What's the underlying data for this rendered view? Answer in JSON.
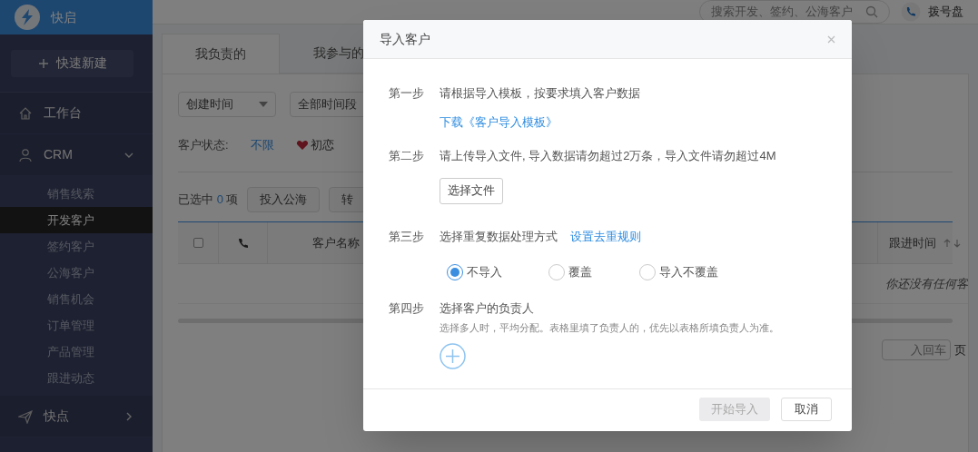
{
  "app": {
    "name": "快启",
    "quick_create": "快速新建"
  },
  "sidebar": {
    "items": [
      {
        "label": "工作台",
        "kind": "home"
      },
      {
        "label": "CRM",
        "kind": "user",
        "expanded": true,
        "children": [
          {
            "label": "销售线索",
            "selected": false
          },
          {
            "label": "开发客户",
            "selected": true
          },
          {
            "label": "签约客户",
            "selected": false
          },
          {
            "label": "公海客户",
            "selected": false
          },
          {
            "label": "销售机会",
            "selected": false
          },
          {
            "label": "订单管理",
            "selected": false
          },
          {
            "label": "产品管理",
            "selected": false
          },
          {
            "label": "跟进动态",
            "selected": false
          }
        ]
      },
      {
        "label": "快点",
        "kind": "send",
        "expanded": false
      }
    ]
  },
  "topbar": {
    "search": {
      "placeholder": "搜索开发、签约、公海客户"
    },
    "dialpad": "拨号盘"
  },
  "tabs": [
    {
      "label": "我负责的",
      "selected": true
    },
    {
      "label": "我参与的",
      "selected": false
    }
  ],
  "filters": [
    {
      "value": "创建时间",
      "dropdown": true
    },
    {
      "value": "全部时间段",
      "dropdown": false
    }
  ],
  "status_filter": {
    "label": "客户状态:",
    "options": [
      {
        "label": "不限",
        "selected": true
      },
      {
        "label": "初恋",
        "selected": false,
        "kind": "heart"
      }
    ]
  },
  "actions": {
    "selected_prefix": "已选中",
    "selected_count": "0",
    "selected_suffix": "项",
    "buttons": [
      "投入公海",
      "转"
    ]
  },
  "table": {
    "columns": [
      {
        "kind": "checkbox",
        "checked": false
      },
      {
        "kind": "phone"
      },
      {
        "kind": "text",
        "label": "客户名称"
      },
      {
        "kind": "sort",
        "label": "跟进时间"
      }
    ],
    "empty_message": "你还没有任何客"
  },
  "pager": {
    "placeholder": "入回车",
    "suffix": "页"
  },
  "modal": {
    "title": "导入客户",
    "steps": [
      {
        "label": "第一步",
        "text": "请根据导入模板，按要求填入客户数据",
        "link": "下载《客户导入模板》"
      },
      {
        "label": "第二步",
        "text": "请上传导入文件, 导入数据请勿超过2万条，导入文件请勿超过4M",
        "button": "选择文件"
      },
      {
        "label": "第三步",
        "text": "选择重复数据处理方式",
        "inline_link": "设置去重规则",
        "options": [
          {
            "label": "不导入",
            "selected": true
          },
          {
            "label": "覆盖",
            "selected": false
          },
          {
            "label": "导入不覆盖",
            "selected": false
          }
        ]
      },
      {
        "label": "第四步",
        "text": "选择客户的负责人",
        "hint": "选择多人时，平均分配。表格里填了负责人的，优先以表格所填负责人为准。",
        "add": true
      }
    ],
    "buttons": [
      {
        "label": "开始导入",
        "disabled": true
      },
      {
        "label": "取消",
        "disabled": false
      }
    ]
  }
}
